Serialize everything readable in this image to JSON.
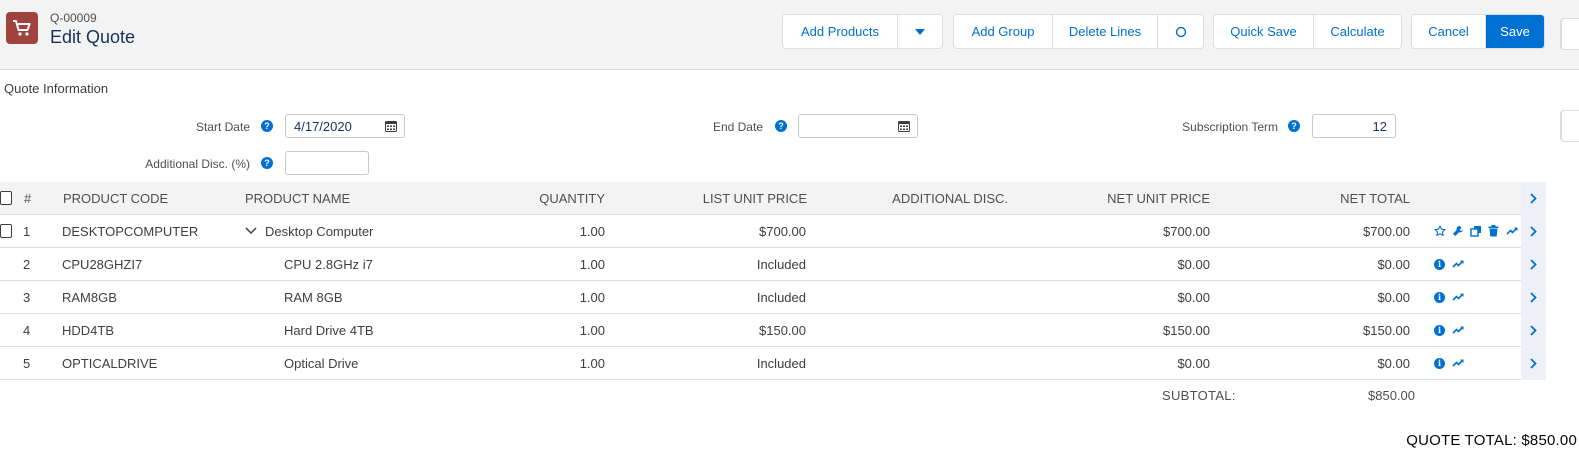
{
  "header": {
    "quote_number": "Q-00009",
    "title": "Edit Quote",
    "buttons": {
      "add_products": "Add Products",
      "add_group": "Add Group",
      "delete_lines": "Delete Lines",
      "quick_save": "Quick Save",
      "calculate": "Calculate",
      "cancel": "Cancel",
      "save": "Save"
    }
  },
  "quote_info": {
    "section_title": "Quote Information",
    "start_date_label": "Start Date",
    "start_date_value": "4/17/2020",
    "end_date_label": "End Date",
    "end_date_value": "",
    "subscription_term_label": "Subscription Term",
    "subscription_term_value": "12",
    "additional_disc_label": "Additional Disc. (%)",
    "additional_disc_value": ""
  },
  "table": {
    "columns": {
      "num": "#",
      "code": "PRODUCT CODE",
      "name": "PRODUCT NAME",
      "qty": "QUANTITY",
      "list": "LIST UNIT PRICE",
      "disc": "ADDITIONAL DISC.",
      "net_unit": "NET UNIT PRICE",
      "net_total": "NET TOTAL"
    },
    "rows": [
      {
        "num": "1",
        "code": "DESKTOPCOMPUTER",
        "name": "Desktop Computer",
        "qty": "1.00",
        "list": "$700.00",
        "disc": "",
        "net_unit": "$700.00",
        "net_total": "$700.00"
      },
      {
        "num": "2",
        "code": "CPU28GHZI7",
        "name": "CPU 2.8GHz i7",
        "qty": "1.00",
        "list": "Included",
        "disc": "",
        "net_unit": "$0.00",
        "net_total": "$0.00"
      },
      {
        "num": "3",
        "code": "RAM8GB",
        "name": "RAM 8GB",
        "qty": "1.00",
        "list": "Included",
        "disc": "",
        "net_unit": "$0.00",
        "net_total": "$0.00"
      },
      {
        "num": "4",
        "code": "HDD4TB",
        "name": "Hard Drive 4TB",
        "qty": "1.00",
        "list": "$150.00",
        "disc": "",
        "net_unit": "$150.00",
        "net_total": "$150.00"
      },
      {
        "num": "5",
        "code": "OPTICALDRIVE",
        "name": "Optical Drive",
        "qty": "1.00",
        "list": "Included",
        "disc": "",
        "net_unit": "$0.00",
        "net_total": "$0.00"
      }
    ]
  },
  "summary": {
    "subtotal_label": "SUBTOTAL:",
    "subtotal_value": "$850.00",
    "quote_total": "QUOTE TOTAL: $850.00"
  },
  "colors": {
    "brand": "#0070d2",
    "app_icon": "#a0433d"
  }
}
